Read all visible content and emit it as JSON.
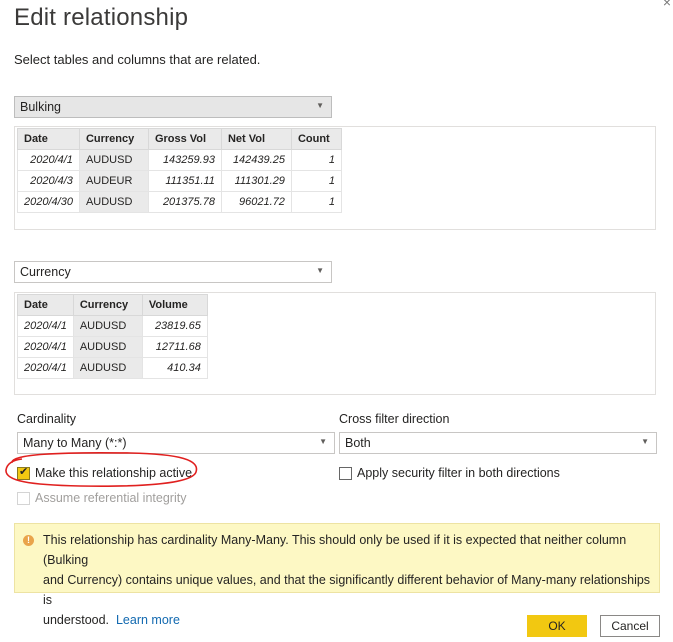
{
  "dialog": {
    "title": "Edit relationship",
    "subtitle": "Select tables and columns that are related."
  },
  "table1": {
    "selected": "Bulking",
    "columns": [
      "Date",
      "Currency",
      "Gross Vol",
      "Net Vol",
      "Count"
    ],
    "rows": [
      [
        "2020/4/1",
        "AUDUSD",
        "143259.93",
        "142439.25",
        "1"
      ],
      [
        "2020/4/3",
        "AUDEUR",
        "111351.11",
        "111301.29",
        "1"
      ],
      [
        "2020/4/30",
        "AUDUSD",
        "201375.78",
        "96021.72",
        "1"
      ]
    ]
  },
  "table2": {
    "selected": "Currency",
    "columns": [
      "Date",
      "Currency",
      "Volume"
    ],
    "rows": [
      [
        "2020/4/1",
        "AUDUSD",
        "23819.65"
      ],
      [
        "2020/4/1",
        "AUDUSD",
        "12711.68"
      ],
      [
        "2020/4/1",
        "AUDUSD",
        "410.34"
      ]
    ]
  },
  "cardinality": {
    "label": "Cardinality",
    "value": "Many to Many (*:*)"
  },
  "cross_filter": {
    "label": "Cross filter direction",
    "value": "Both"
  },
  "checkboxes": {
    "active": {
      "label": "Make this relationship active",
      "checked": true
    },
    "security": {
      "label": "Apply security filter in both directions",
      "checked": false
    },
    "integrity": {
      "label": "Assume referential integrity",
      "checked": false,
      "disabled": true
    }
  },
  "warning": {
    "line1": "This relationship has cardinality Many-Many. This should only be used if it is expected that neither column (Bulking",
    "line2": "and Currency) contains unique values, and that the significantly different behavior of Many-many relationships is",
    "line3": "understood.",
    "link": "Learn more"
  },
  "buttons": {
    "ok": "OK",
    "cancel": "Cancel"
  },
  "colors": {
    "accent": "#f2c811",
    "link": "#1269b0",
    "annotation": "#e0201f",
    "warning_bg": "#fdf8c4"
  }
}
